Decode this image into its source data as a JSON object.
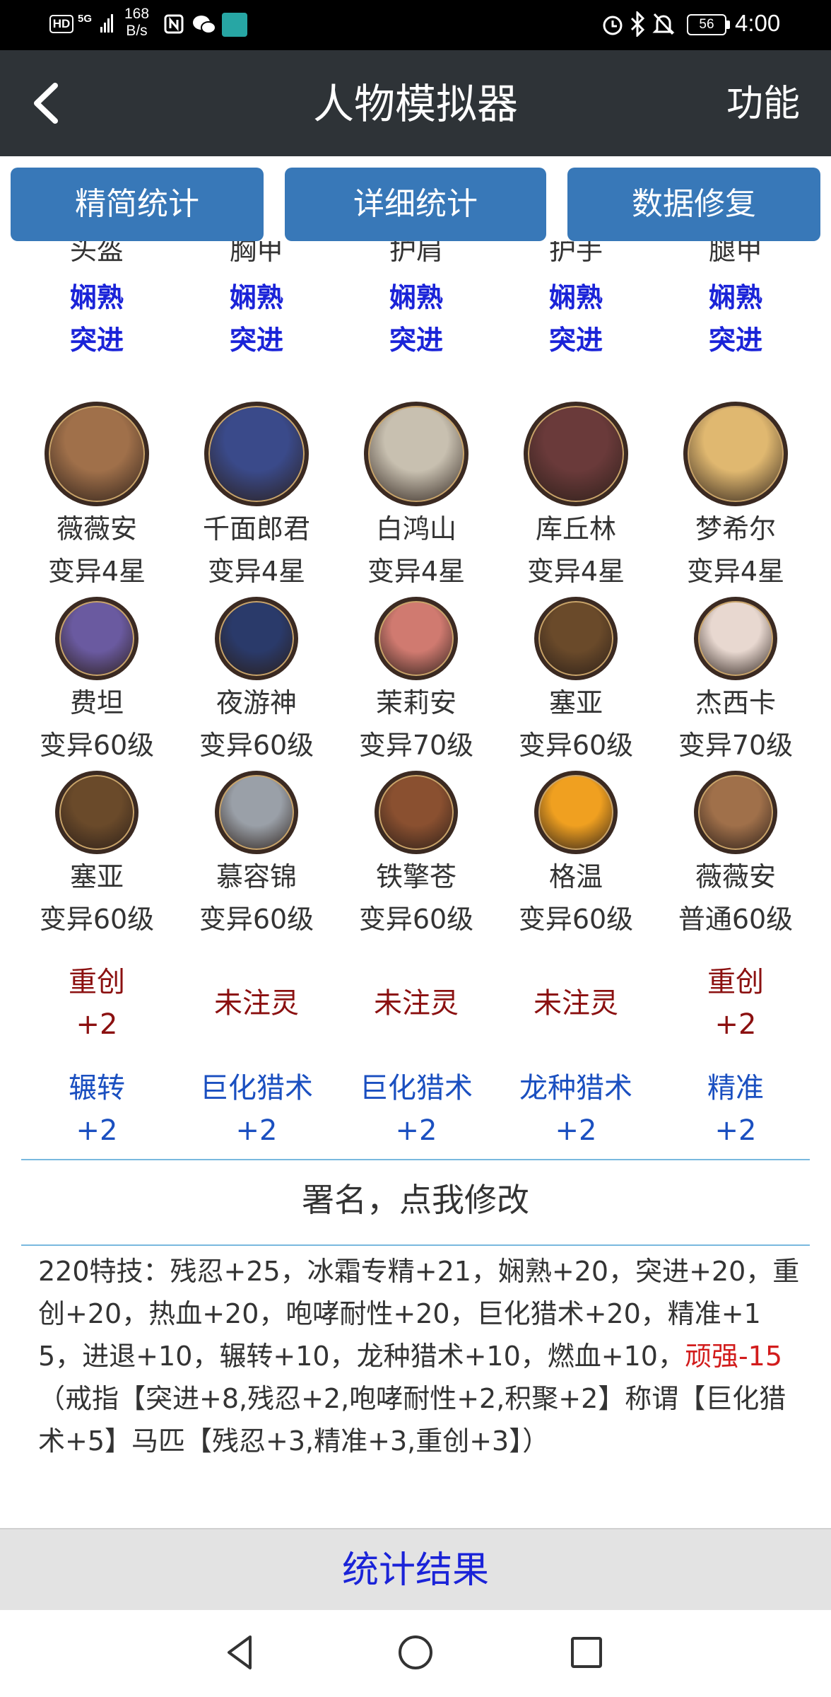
{
  "status_bar": {
    "hd": "HD",
    "network": "5G",
    "speed_value": "168",
    "speed_unit": "B/s",
    "battery": "56",
    "time": "4:00"
  },
  "header": {
    "title": "人物模拟器",
    "function_label": "功能"
  },
  "top_buttons": {
    "simple": "精简统计",
    "detailed": "详细统计",
    "repair": "数据修复"
  },
  "equipment": {
    "slots_cut": [
      "头盔",
      "胸甲",
      "护肩",
      "护手",
      "腿甲"
    ],
    "gems": [
      {
        "line1": "娴熟",
        "line2": "突进"
      },
      {
        "line1": "娴熟",
        "line2": "突进"
      },
      {
        "line1": "娴熟",
        "line2": "突进"
      },
      {
        "line1": "娴熟",
        "line2": "突进"
      },
      {
        "line1": "娴熟",
        "line2": "突进"
      }
    ]
  },
  "generals": [
    {
      "name": "薇薇安",
      "level": "变异4星",
      "color": "#a0704a"
    },
    {
      "name": "千面郎君",
      "level": "变异4星",
      "color": "#3a4a8a"
    },
    {
      "name": "白鸿山",
      "level": "变异4星",
      "color": "#c8c0b0"
    },
    {
      "name": "库丘林",
      "level": "变异4星",
      "color": "#6a3a3a"
    },
    {
      "name": "梦希尔",
      "level": "变异4星",
      "color": "#e0b870"
    }
  ],
  "soldiers_row1": [
    {
      "name": "费坦",
      "level": "变异60级",
      "color": "#6a5aa0"
    },
    {
      "name": "夜游神",
      "level": "变异60级",
      "color": "#2a3a6a"
    },
    {
      "name": "茉莉安",
      "level": "变异70级",
      "color": "#d07a70"
    },
    {
      "name": "塞亚",
      "level": "变异60级",
      "color": "#6a4a2a"
    },
    {
      "name": "杰西卡",
      "level": "变异70级",
      "color": "#e8d8d0"
    }
  ],
  "soldiers_row2": [
    {
      "name": "塞亚",
      "level": "变异60级",
      "color": "#6a4a2a"
    },
    {
      "name": "慕容锦",
      "level": "变异60级",
      "color": "#9aa0a8"
    },
    {
      "name": "铁擎苍",
      "level": "变异60级",
      "color": "#8a5030"
    },
    {
      "name": "格温",
      "level": "变异60级",
      "color": "#f0a020"
    },
    {
      "name": "薇薇安",
      "level": "普通60级",
      "color": "#a0704a"
    }
  ],
  "spirit": [
    {
      "line1": "重创",
      "line2": "+2"
    },
    {
      "line1": "未注灵",
      "line2": ""
    },
    {
      "line1": "未注灵",
      "line2": ""
    },
    {
      "line1": "未注灵",
      "line2": ""
    },
    {
      "line1": "重创",
      "line2": "+2"
    }
  ],
  "skills_row": [
    {
      "line1": "辗转",
      "line2": "+2"
    },
    {
      "line1": "巨化猎术",
      "line2": "+2"
    },
    {
      "line1": "巨化猎术",
      "line2": "+2"
    },
    {
      "line1": "龙种猎术",
      "line2": "+2"
    },
    {
      "line1": "精准",
      "line2": "+2"
    }
  ],
  "signature": "署名，点我修改",
  "skills_summary": {
    "part1": "220特技：残忍+25，冰霜专精+21，娴熟+20，突进+20，重创+20，热血+20，咆哮耐性+20，巨化猎术+20，精准+15，进退+10，辗转+10，龙种猎术+10，燃血+10，",
    "negative": "顽强-15",
    "part2": "（戒指【突进+8,残忍+2,咆哮耐性+2,积聚+2】称谓【巨化猎术+5】马匹【残忍+3,精准+3,重创+3】）"
  },
  "result_button": "统计结果",
  "colors": {
    "button_blue": "#3878b8",
    "gem_blue": "#1a23d8",
    "spirit_red": "#8b1010",
    "negative_red": "#d21c1c",
    "header_dark": "#2e3337"
  }
}
